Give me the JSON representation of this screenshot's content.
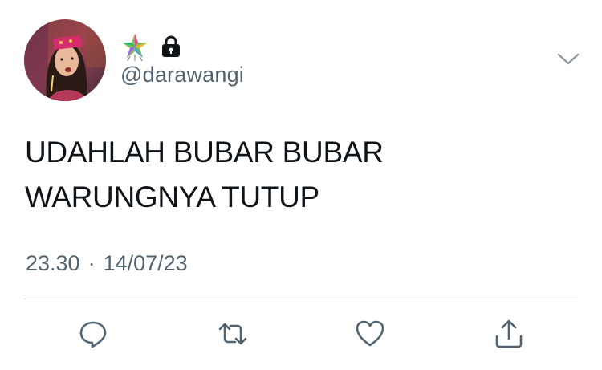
{
  "tweet": {
    "display_name_icons": [
      "star-emoji-icon",
      "lock-icon"
    ],
    "handle": "@darawangi",
    "text_lines": [
      "UDAHLAH BUBAR BUBAR",
      "WARUNGNYA TUTUP"
    ],
    "time": "23.30",
    "separator": "·",
    "date": "14/07/23"
  },
  "actions": {
    "icons": [
      "reply-icon",
      "retweet-icon",
      "like-icon",
      "share-icon"
    ]
  },
  "colors": {
    "text": "#0f1419",
    "secondary": "#536471",
    "divider": "#cfd9de"
  }
}
